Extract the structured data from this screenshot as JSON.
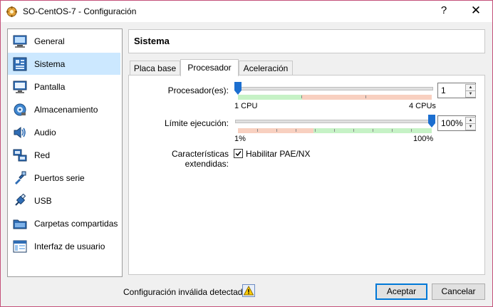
{
  "window": {
    "title": "SO-CentOS-7 - Configuración",
    "help_label": "?",
    "close_label": "✕"
  },
  "sidebar": {
    "items": [
      {
        "label": "General",
        "icon": "monitor-general-icon",
        "selected": false
      },
      {
        "label": "Sistema",
        "icon": "motherboard-icon",
        "selected": true
      },
      {
        "label": "Pantalla",
        "icon": "display-icon",
        "selected": false
      },
      {
        "label": "Almacenamiento",
        "icon": "storage-disk-icon",
        "selected": false
      },
      {
        "label": "Audio",
        "icon": "speaker-icon",
        "selected": false
      },
      {
        "label": "Red",
        "icon": "network-icon",
        "selected": false
      },
      {
        "label": "Puertos serie",
        "icon": "serial-port-icon",
        "selected": false
      },
      {
        "label": "USB",
        "icon": "usb-icon",
        "selected": false
      },
      {
        "label": "Carpetas compartidas",
        "icon": "shared-folder-icon",
        "selected": false
      },
      {
        "label": "Interfaz de usuario",
        "icon": "user-interface-icon",
        "selected": false
      }
    ]
  },
  "section": {
    "title": "Sistema"
  },
  "tabs": [
    {
      "label": "Placa base",
      "active": false
    },
    {
      "label": "Procesador",
      "active": true
    },
    {
      "label": "Aceleración",
      "active": false
    }
  ],
  "processor": {
    "cpu_label": "Procesador(es):",
    "cpu_value": "1",
    "cpu_min_label": "1 CPU",
    "cpu_max_label": "4 CPUs",
    "cpu_fraction": 0,
    "exec_label": "Límite ejecución:",
    "exec_value": "100%",
    "exec_min_label": "1%",
    "exec_max_label": "100%",
    "exec_fraction": 1,
    "ext_label": "Características extendidas:",
    "pae_label": "Habilitar PAE/NX",
    "pae_checked": true
  },
  "footer": {
    "invalid_text": "Configuración inválida detectada",
    "accept_label": "Aceptar",
    "cancel_label": "Cancelar"
  },
  "colors": {
    "selected_bg": "#cce8ff",
    "slider_green": "#c6f2c6",
    "slider_red": "#f8d0c0",
    "handle_blue": "#1c6fd0",
    "accent": "#0078d7"
  }
}
